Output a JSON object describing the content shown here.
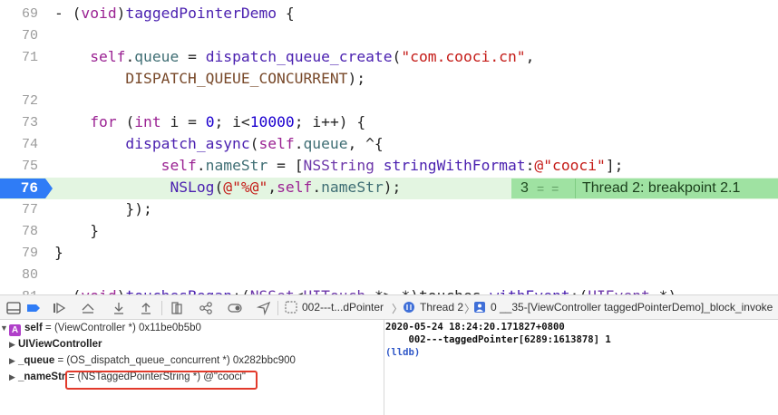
{
  "editor": {
    "lines": [
      {
        "num": "69",
        "tokens": [
          [
            "plain",
            "- ("
          ],
          [
            "kw",
            "void"
          ],
          [
            "plain",
            ")"
          ],
          [
            "fn",
            "taggedPointerDemo"
          ],
          [
            "plain",
            " {"
          ]
        ]
      },
      {
        "num": "70",
        "tokens": []
      },
      {
        "num": "71",
        "tokens": [
          [
            "plain",
            "    "
          ],
          [
            "self",
            "self"
          ],
          [
            "plain",
            "."
          ],
          [
            "prop",
            "queue"
          ],
          [
            "plain",
            " = "
          ],
          [
            "fn",
            "dispatch_queue_create"
          ],
          [
            "plain",
            "("
          ],
          [
            "str",
            "\"com.cooci.cn\""
          ],
          [
            "plain",
            ","
          ]
        ]
      },
      {
        "num": "",
        "tokens": [
          [
            "plain",
            "        "
          ],
          [
            "macro",
            "DISPATCH_QUEUE_CONCURRENT"
          ],
          [
            "plain",
            ");"
          ]
        ]
      },
      {
        "num": "72",
        "tokens": []
      },
      {
        "num": "73",
        "tokens": [
          [
            "plain",
            "    "
          ],
          [
            "kw",
            "for"
          ],
          [
            "plain",
            " ("
          ],
          [
            "kw",
            "int"
          ],
          [
            "plain",
            " i = "
          ],
          [
            "num",
            "0"
          ],
          [
            "plain",
            "; i<"
          ],
          [
            "num",
            "10000"
          ],
          [
            "plain",
            "; i++) {"
          ]
        ]
      },
      {
        "num": "74",
        "tokens": [
          [
            "plain",
            "        "
          ],
          [
            "fn",
            "dispatch_async"
          ],
          [
            "plain",
            "("
          ],
          [
            "self",
            "self"
          ],
          [
            "plain",
            "."
          ],
          [
            "prop",
            "queue"
          ],
          [
            "plain",
            ", ^{"
          ]
        ]
      },
      {
        "num": "75",
        "tokens": [
          [
            "plain",
            "            "
          ],
          [
            "self",
            "self"
          ],
          [
            "plain",
            "."
          ],
          [
            "prop",
            "nameStr"
          ],
          [
            "plain",
            " = ["
          ],
          [
            "cls",
            "NSString"
          ],
          [
            "plain",
            " "
          ],
          [
            "fn",
            "stringWithFormat"
          ],
          [
            "plain",
            ":"
          ],
          [
            "str",
            "@\"cooci\""
          ],
          [
            "plain",
            "];"
          ]
        ]
      },
      {
        "num": "76",
        "tokens": [
          [
            "plain",
            "             "
          ],
          [
            "fn",
            "NSLog"
          ],
          [
            "plain",
            "("
          ],
          [
            "str",
            "@\"%@\""
          ],
          [
            "plain",
            ","
          ],
          [
            "self",
            "self"
          ],
          [
            "plain",
            "."
          ],
          [
            "prop",
            "nameStr"
          ],
          [
            "plain",
            ");"
          ]
        ],
        "breakpoint": true
      },
      {
        "num": "77",
        "tokens": [
          [
            "plain",
            "        });"
          ]
        ]
      },
      {
        "num": "78",
        "tokens": [
          [
            "plain",
            "    }"
          ]
        ]
      },
      {
        "num": "79",
        "tokens": [
          [
            "plain",
            "}"
          ]
        ]
      },
      {
        "num": "80",
        "tokens": []
      },
      {
        "num": "81",
        "tokens": [
          [
            "plain",
            "- ("
          ],
          [
            "kw",
            "void"
          ],
          [
            "plain",
            ")"
          ],
          [
            "fn",
            "touchesBegan"
          ],
          [
            "plain",
            ":("
          ],
          [
            "cls",
            "NSSet"
          ],
          [
            "plain",
            "<"
          ],
          [
            "cls",
            "UITouch"
          ],
          [
            "plain",
            " *> *)touches "
          ],
          [
            "fn",
            "withEvent"
          ],
          [
            "plain",
            ":("
          ],
          [
            "cls",
            "UIEvent"
          ],
          [
            "plain",
            " *)"
          ]
        ]
      }
    ],
    "breakpoint": {
      "count": "3",
      "eq": "= =",
      "thread_label": "Thread 2: breakpoint 2.1"
    }
  },
  "toolbar": {
    "breadcrumb_target": "002---t...dPointer",
    "breadcrumb_thread": "Thread 2",
    "breadcrumb_frame": "0 __35-[ViewController taggedPointerDemo]_block_invoke"
  },
  "variables": [
    {
      "name": "self",
      "value": "= (ViewController *) 0x11be0b5b0",
      "badge": "A",
      "expanded": true
    },
    {
      "name": "UIViewController",
      "value": "",
      "collapsed": true
    },
    {
      "name": "_queue",
      "value": "= (OS_dispatch_queue_concurrent *) 0x282bbc900",
      "collapsed": true
    },
    {
      "name": "_nameStr",
      "value": "= (NSTaggedPointerString *) @\"cooci\"",
      "collapsed": true
    }
  ],
  "console": {
    "lines": [
      "2020-05-24 18:24:20.171827+0800",
      "    002---taggedPointer[6289:1613878] 1",
      "(lldb)"
    ]
  },
  "colors": {
    "breakpoint_blue": "#2f7cf6",
    "breakpoint_row": "#e3f5e1",
    "breakpoint_badge": "#9fe2a2",
    "highlight_box": "#e23a2b"
  }
}
